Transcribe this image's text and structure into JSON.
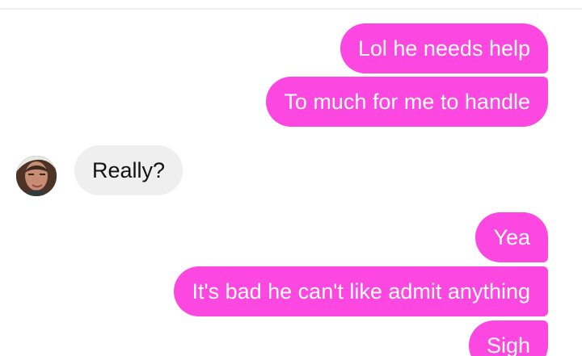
{
  "conversation": {
    "messages": [
      {
        "sender": "me",
        "text": "Lol he needs help"
      },
      {
        "sender": "me",
        "text": "To much for me to handle"
      },
      {
        "sender": "contact",
        "text": "Really?"
      },
      {
        "sender": "me",
        "text": "Yea"
      },
      {
        "sender": "me",
        "text": "It's bad he can't like admit anything"
      },
      {
        "sender": "me",
        "text": "Sigh"
      }
    ]
  },
  "contact": {
    "avatar_icon": "profile-photo-icon"
  },
  "colors": {
    "outgoing_bubble": "#fc47e0",
    "incoming_bubble": "#efefef",
    "outgoing_text": "#ffffff",
    "incoming_text": "#111111"
  }
}
